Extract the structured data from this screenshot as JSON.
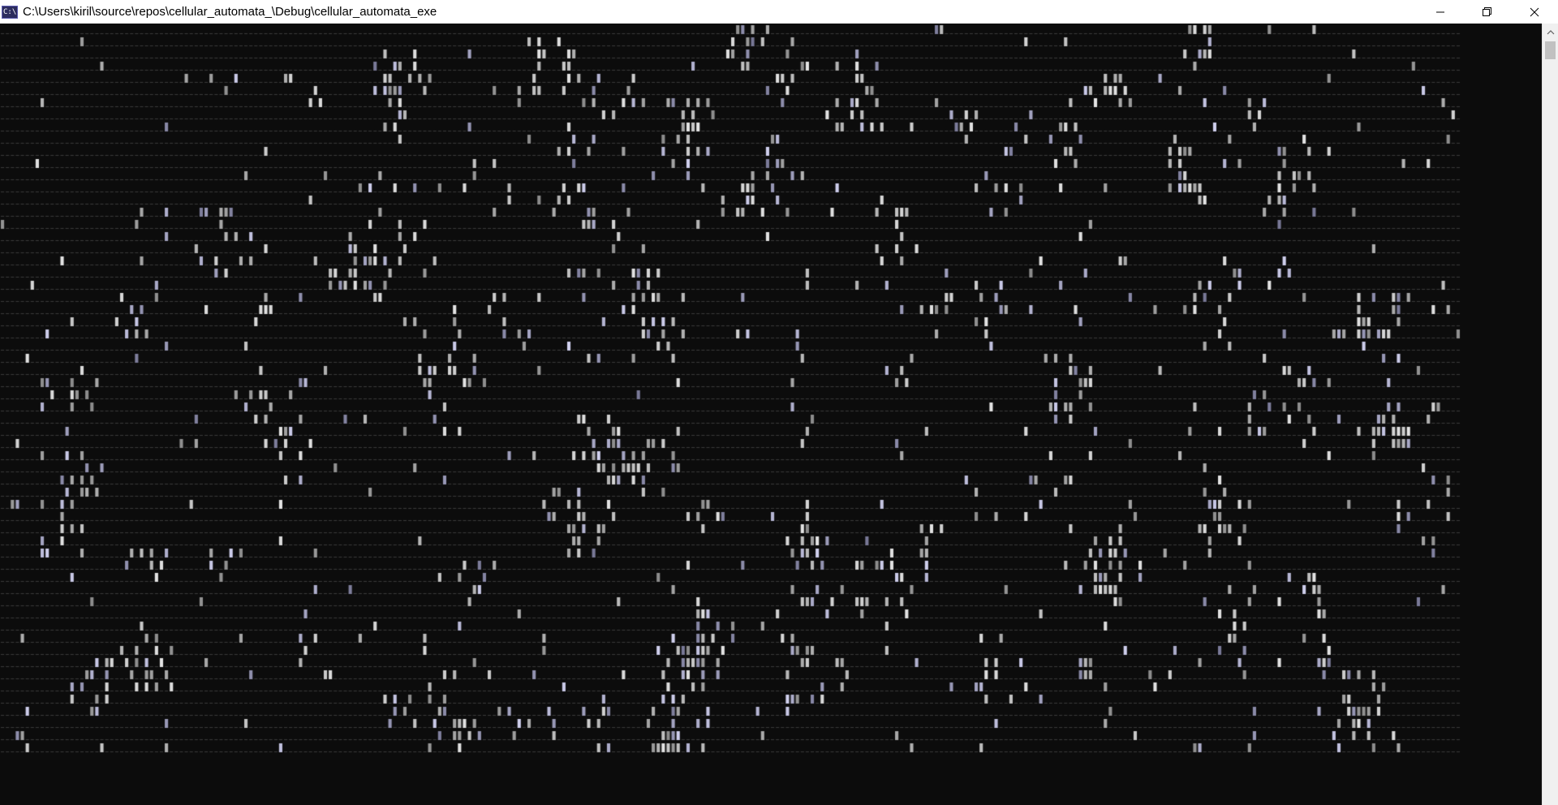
{
  "window": {
    "title": "C:\\Users\\kiril\\source\\repos\\cellular_automata_\\Debug\\cellular_automata_exe",
    "icon": "console-app-icon",
    "icon_glyph": "C:\\"
  },
  "caption_buttons": [
    {
      "name": "minimize-button",
      "icon": "minimize-icon"
    },
    {
      "name": "restore-button",
      "icon": "restore-icon"
    },
    {
      "name": "close-button",
      "icon": "close-icon"
    }
  ],
  "console": {
    "background_color": "#0c0c0c",
    "cell_color": "#cccccc",
    "background_char_color": "#3a3a3a",
    "columns": 294,
    "rows": 60,
    "live_char": "█",
    "dead_char": "."
  },
  "scrollbar": {
    "icon_up": "chevron-up-icon"
  }
}
